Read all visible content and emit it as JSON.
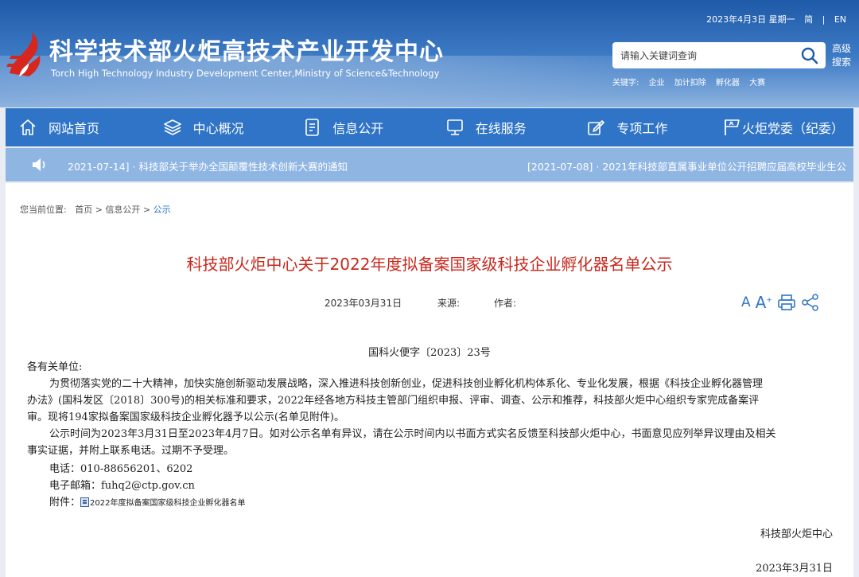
{
  "header": {
    "title_cn": "科学技术部火炬高技术产业开发中心",
    "title_en": "Torch High Technology Industry Development Center,Ministry of Science&Technology",
    "date": "2023年4月3日 星期一",
    "lang_simplified": "简",
    "separator": "|",
    "lang_en": "EN",
    "search_placeholder": "请输入关键词查询",
    "adv_search": "高级搜索",
    "keywords_label": "关键字:",
    "keywords": [
      "企业",
      "加计扣除",
      "孵化器",
      "大赛"
    ]
  },
  "nav": {
    "items": [
      {
        "label": "网站首页",
        "icon": "home-icon"
      },
      {
        "label": "中心概况",
        "icon": "layers-icon"
      },
      {
        "label": "信息公开",
        "icon": "document-icon"
      },
      {
        "label": "在线服务",
        "icon": "monitor-icon"
      },
      {
        "label": "专项工作",
        "icon": "edit-icon"
      },
      {
        "label": "火炬党委（纪委）",
        "icon": "party-icon"
      }
    ]
  },
  "ticker": {
    "item1": "2021-07-14] · 科技部关于举办全国颠覆性技术创新大赛的通知",
    "item2": "[2021-07-08] · 2021年科技部直属事业单位公开招聘应届高校毕业生公"
  },
  "breadcrumb": {
    "label": "您当前位置:",
    "home": "首页",
    "sep": ">",
    "section": "信息公开",
    "current": "公示"
  },
  "article": {
    "title": "科技部火炬中心关于2022年度拟备案国家级科技企业孵化器名单公示",
    "date": "2023年03月31日",
    "source_label": "来源:",
    "author_label": "作者:",
    "font_small": "A",
    "font_large": "A",
    "doc_no": "国科火便字〔2023〕23号",
    "salutation": "各有关单位:",
    "p1_l1": "为贯彻落实党的二十大精神，加快实施创新驱动发展战略，深入推进科技创新创业，促进科技创业孵化机构体系化、专业化发展，根据《科技企业孵化器管理",
    "p1_l2": "办法》(国科发区〔2018〕300号)的相关标准和要求，2022年经各地方科技主管部门组织申报、评审、调查、公示和推荐，科技部火炬中心组织专家完成备案评",
    "p1_l3": "审。现将194家拟备案国家级科技企业孵化器予以公示(名单见附件)。",
    "p2_l1": "公示时间为2023年3月31日至2023年4月7日。如对公示名单有异议，请在公示时间内以书面方式实名反馈至科技部火炬中心，书面意见应列举异议理由及相关",
    "p2_l2": "事实证据，并附上联系电话。过期不予受理。",
    "phone": "电话：010-88656201、6202",
    "email": "电子邮箱：fuhq2@ctp.gov.cn",
    "attach_label": "附件：",
    "attach_name": "2022年度拟备案国家级科技企业孵化器名单",
    "signer": "科技部火炬中心",
    "sign_date": "2023年3月31日"
  },
  "colors": {
    "nav_bg": "#2f74c6",
    "ticker_bg": "#8fb5e3",
    "title_red": "#c7281d"
  }
}
